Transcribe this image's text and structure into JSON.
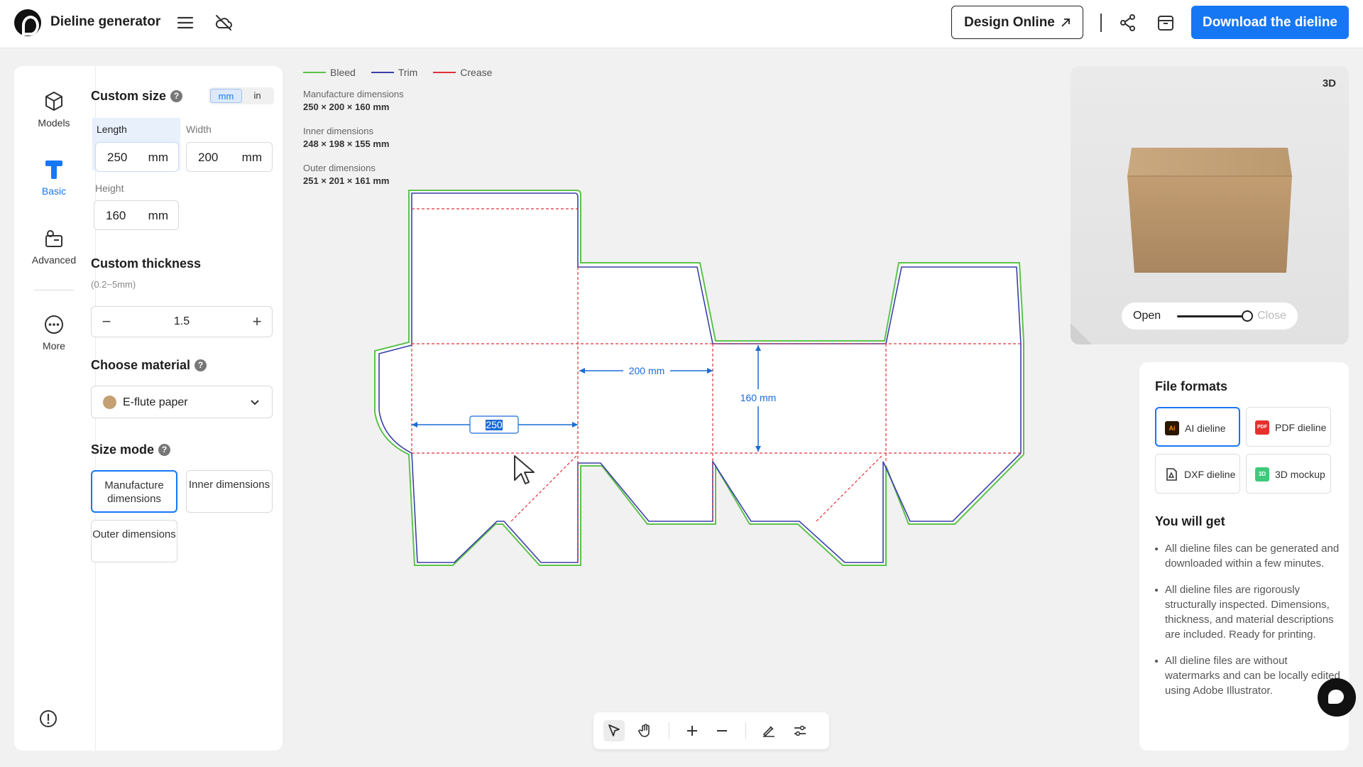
{
  "header": {
    "app_title": "Dieline generator",
    "design_online_label": "Design Online",
    "download_label": "Download the dieline",
    "icons": [
      "hamburger-icon",
      "cloud-off-icon",
      "share-icon",
      "archive-icon",
      "arrow-up-right-icon"
    ]
  },
  "rail": {
    "items": [
      {
        "label": "Models",
        "icon": "cube-icon"
      },
      {
        "label": "Basic",
        "icon": "ruler-t-icon"
      },
      {
        "label": "Advanced",
        "icon": "gear-box-icon"
      },
      {
        "label": "More",
        "icon": "more-circle-icon"
      }
    ],
    "active": "Basic"
  },
  "size": {
    "title": "Custom size",
    "units": [
      "mm",
      "in"
    ],
    "selected_unit": "mm",
    "length_label": "Length",
    "length_value": "250",
    "width_label": "Width",
    "width_value": "200",
    "height_label": "Height",
    "height_value": "160",
    "unit": "mm"
  },
  "thickness": {
    "title": "Custom thickness",
    "range": "(0.2~5mm)",
    "value": "1.5",
    "minus": "−",
    "plus": "+"
  },
  "material": {
    "title": "Choose material",
    "value": "E-flute paper",
    "color": "#c4a073"
  },
  "size_mode": {
    "title": "Size mode",
    "options": [
      "Manufacture dimensions",
      "Inner dimensions",
      "Outer dimensions"
    ],
    "selected": "Manufacture dimensions"
  },
  "legend": [
    {
      "label": "Bleed",
      "color": "#5cc24a"
    },
    {
      "label": "Trim",
      "color": "#3b3fa8"
    },
    {
      "label": "Crease",
      "color": "#e0303a"
    }
  ],
  "dimensions": {
    "manufacture_label": "Manufacture dimensions",
    "manufacture_value": "250 × 200 × 160 mm",
    "inner_label": "Inner dimensions",
    "inner_value": "248 × 198 × 155 mm",
    "outer_label": "Outer dimensions",
    "outer_value": "251 × 201 × 161 mm"
  },
  "dieline_labels": {
    "length": "250",
    "width": "200 mm",
    "height": "160 mm"
  },
  "preview": {
    "badge": "3D",
    "open_label": "Open",
    "close_label": "Close",
    "openness": 0.95
  },
  "formats": {
    "title": "File formats",
    "items": [
      {
        "label": "AI dieline",
        "icon_text": "Ai",
        "color": "#2b1600"
      },
      {
        "label": "PDF dieline",
        "icon_text": "PDF",
        "color": "#e5302d"
      },
      {
        "label": "DXF dieline",
        "icon_text": "",
        "color": "#333333"
      },
      {
        "label": "3D mockup",
        "icon_text": "3D",
        "color": "#3ec97b"
      }
    ],
    "selected": "AI dieline",
    "get_title": "You will get",
    "bullets": [
      "All dieline files can be generated and downloaded within a few minutes.",
      "All dieline files are rigorously structurally inspected. Dimensions, thickness, and material descriptions are included. Ready for printing.",
      "All dieline files are without watermarks and can be locally edited using Adobe Illustrator."
    ]
  },
  "accent_color": "#1677f5"
}
